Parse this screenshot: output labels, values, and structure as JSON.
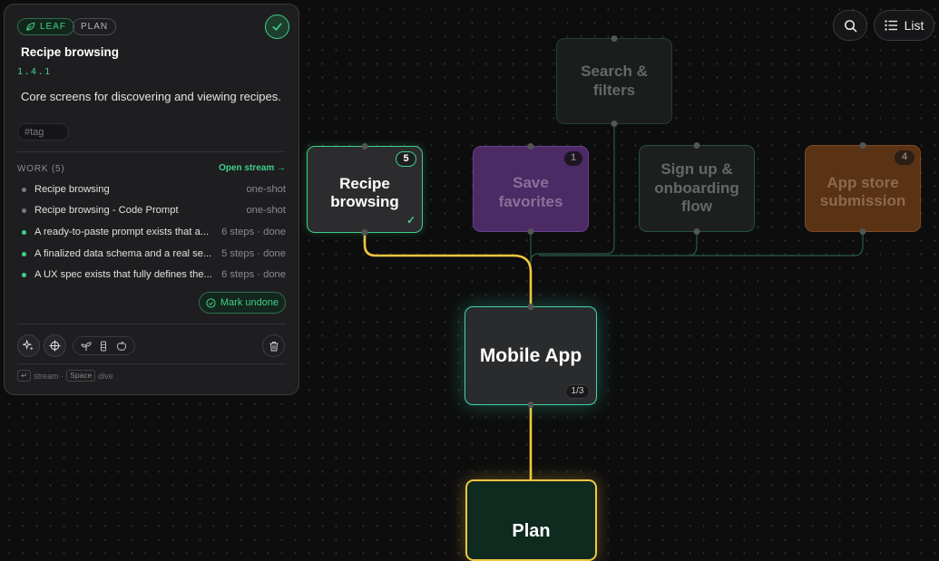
{
  "toolbar": {
    "search_icon": "search-icon",
    "list_label": "List"
  },
  "nodes": {
    "search_filters": {
      "label": "Search & filters"
    },
    "recipe_browsing": {
      "label": "Recipe browsing",
      "count": "5"
    },
    "save_favorites": {
      "label": "Save favorites",
      "count": "1"
    },
    "signup": {
      "label": "Sign up & onboarding flow"
    },
    "app_store": {
      "label": "App store submission",
      "count": "4"
    },
    "mobile_app": {
      "label": "Mobile App",
      "progress": "1/3"
    },
    "plan": {
      "label": "Plan"
    }
  },
  "colors": {
    "accent_green": "#3fd088",
    "edge_yellow": "#f3c640",
    "save_purple": "#4b2a66",
    "store_orange": "#5a3214"
  },
  "panel": {
    "chips": {
      "leaf": "LEAF",
      "plan": "PLAN"
    },
    "title": "Recipe browsing",
    "id": "1.4.1",
    "description": "Core screens for discovering and viewing recipes.",
    "tag_placeholder": "#tag",
    "work_header": "WORK (5)",
    "open_stream": "Open stream →",
    "work_items": [
      {
        "text": "Recipe browsing",
        "meta": "one-shot",
        "status": "gray"
      },
      {
        "text": "Recipe browsing - Code Prompt",
        "meta": "one-shot",
        "status": "gray"
      },
      {
        "text": "A ready-to-paste prompt exists that a...",
        "meta": "6 steps · done",
        "status": "green"
      },
      {
        "text": "A finalized data schema and a real se...",
        "meta": "5 steps · done",
        "status": "green"
      },
      {
        "text": "A UX spec exists that fully defines the...",
        "meta": "6 steps · done",
        "status": "green"
      }
    ],
    "mark_undone": "Mark undone",
    "hint": {
      "stream": "stream ·",
      "space_key": "Space",
      "dive": "dive"
    }
  }
}
